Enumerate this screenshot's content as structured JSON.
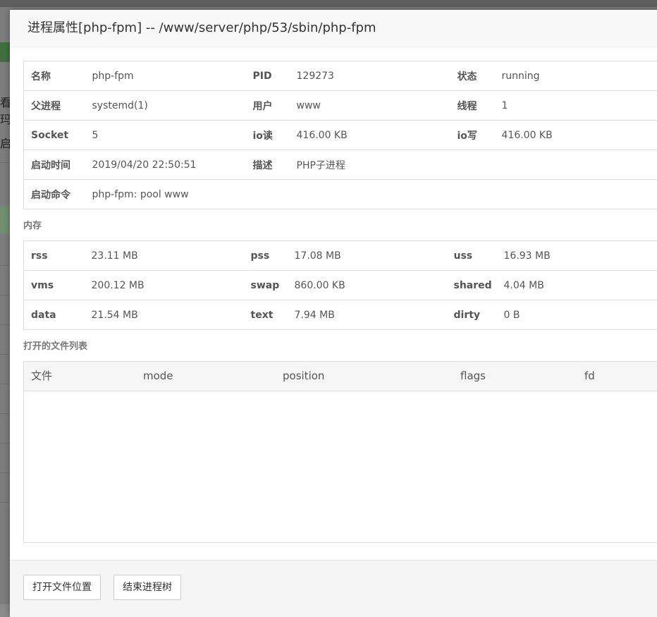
{
  "dialog": {
    "title": "进程属性[php-fpm] -- /www/server/php/53/sbin/php-fpm"
  },
  "info": {
    "rows": [
      [
        {
          "label": "名称",
          "value": "php-fpm"
        },
        {
          "label": "PID",
          "value": "129273"
        },
        {
          "label": "状态",
          "value": "running"
        }
      ],
      [
        {
          "label": "父进程",
          "value": "systemd(1)"
        },
        {
          "label": "用户",
          "value": "www"
        },
        {
          "label": "线程",
          "value": "1"
        }
      ],
      [
        {
          "label": "Socket",
          "value": "5"
        },
        {
          "label": "io读",
          "value": "416.00 KB"
        },
        {
          "label": "io写",
          "value": "416.00 KB"
        }
      ],
      [
        {
          "label": "启动时间",
          "value": "2019/04/20 22:50:51"
        },
        {
          "label": "描述",
          "value": "PHP子进程"
        },
        {
          "label": "",
          "value": ""
        }
      ],
      [
        {
          "label": "启动命令",
          "value": "php-fpm: pool www"
        },
        {
          "label": "",
          "value": ""
        },
        {
          "label": "",
          "value": ""
        }
      ]
    ]
  },
  "memory": {
    "title": "内存",
    "rows": [
      [
        {
          "label": "rss",
          "value": "23.11 MB"
        },
        {
          "label": "pss",
          "value": "17.08 MB"
        },
        {
          "label": "uss",
          "value": "16.93 MB"
        }
      ],
      [
        {
          "label": "vms",
          "value": "200.12 MB"
        },
        {
          "label": "swap",
          "value": "860.00 KB"
        },
        {
          "label": "shared",
          "value": "4.04 MB"
        }
      ],
      [
        {
          "label": "data",
          "value": "21.54 MB"
        },
        {
          "label": "text",
          "value": "7.94 MB"
        },
        {
          "label": "dirty",
          "value": "0 B"
        }
      ]
    ]
  },
  "files": {
    "title": "打开的文件列表",
    "columns": [
      "文件",
      "mode",
      "position",
      "flags",
      "fd"
    ]
  },
  "buttons": {
    "open_location": "打开文件位置",
    "kill_tree": "结束进程树"
  },
  "background": {
    "chars": [
      "看玛",
      "启"
    ]
  }
}
